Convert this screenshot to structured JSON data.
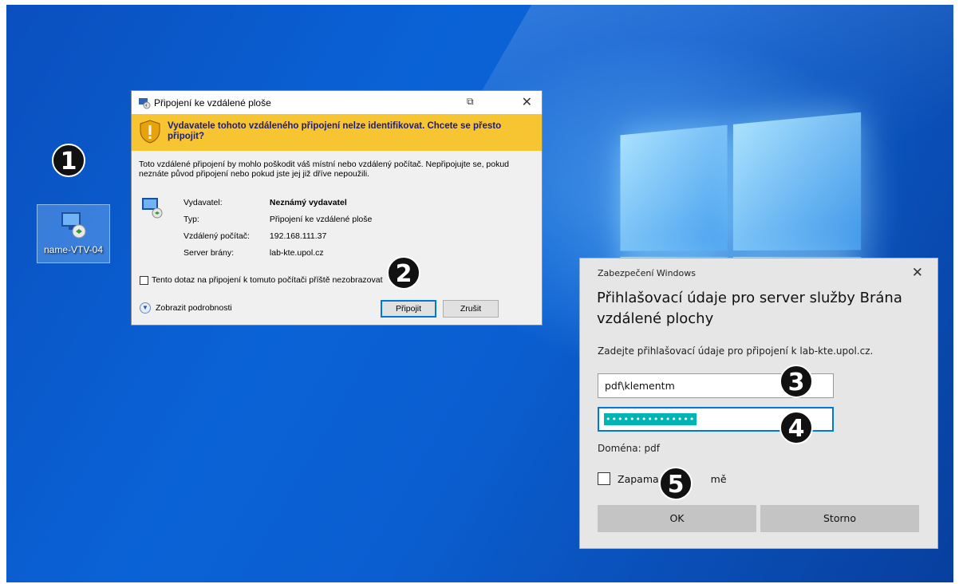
{
  "desktop": {
    "icon_label": "name-VTV-04"
  },
  "badges": [
    "1",
    "2",
    "3",
    "4",
    "5"
  ],
  "rdp_dialog": {
    "title": "Připojení ke vzdálené ploše",
    "warning": "Vydavatele tohoto vzdáleného připojení nelze identifikovat. Chcete se přesto připojit?",
    "description": "Toto vzdálené připojení by mohlo poškodit váš místní nebo vzdálený počítač. Nepřipojujte se, pokud neznáte původ připojení nebo pokud jste jej již dříve nepoužili.",
    "fields": [
      {
        "key": "Vydavatel:",
        "value": "Neznámý vydavatel"
      },
      {
        "key": "Typ:",
        "value": "Připojení ke vzdálené ploše"
      },
      {
        "key": "Vzdálený počítač:",
        "value": "192.168.111.37"
      },
      {
        "key": "Server brány:",
        "value": "lab-kte.upol.cz"
      }
    ],
    "checkbox_label": "Tento dotaz na připojení k tomuto počítači příště nezobrazovat",
    "details_label": "Zobrazit podrobnosti",
    "connect_label": "Připojit",
    "cancel_label": "Zrušit"
  },
  "security_dialog": {
    "title": "Zabezpečení Windows",
    "heading": "Přihlašovací údaje pro server služby Brána vzdálené plochy",
    "description": "Zadejte přihlašovací údaje pro připojení k lab-kte.upol.cz.",
    "username_value": "pdf\\klementm",
    "password_mask": "•••••••••••••••",
    "domain_label": "Doména: pdf",
    "remember_label_start": "Zapama",
    "remember_label_end": "mě",
    "ok_label": "OK",
    "cancel_label": "Storno"
  },
  "colors": {
    "accent": "#0078d7",
    "warning_bar": "#f7c531",
    "password_selection": "#00b4b4"
  }
}
